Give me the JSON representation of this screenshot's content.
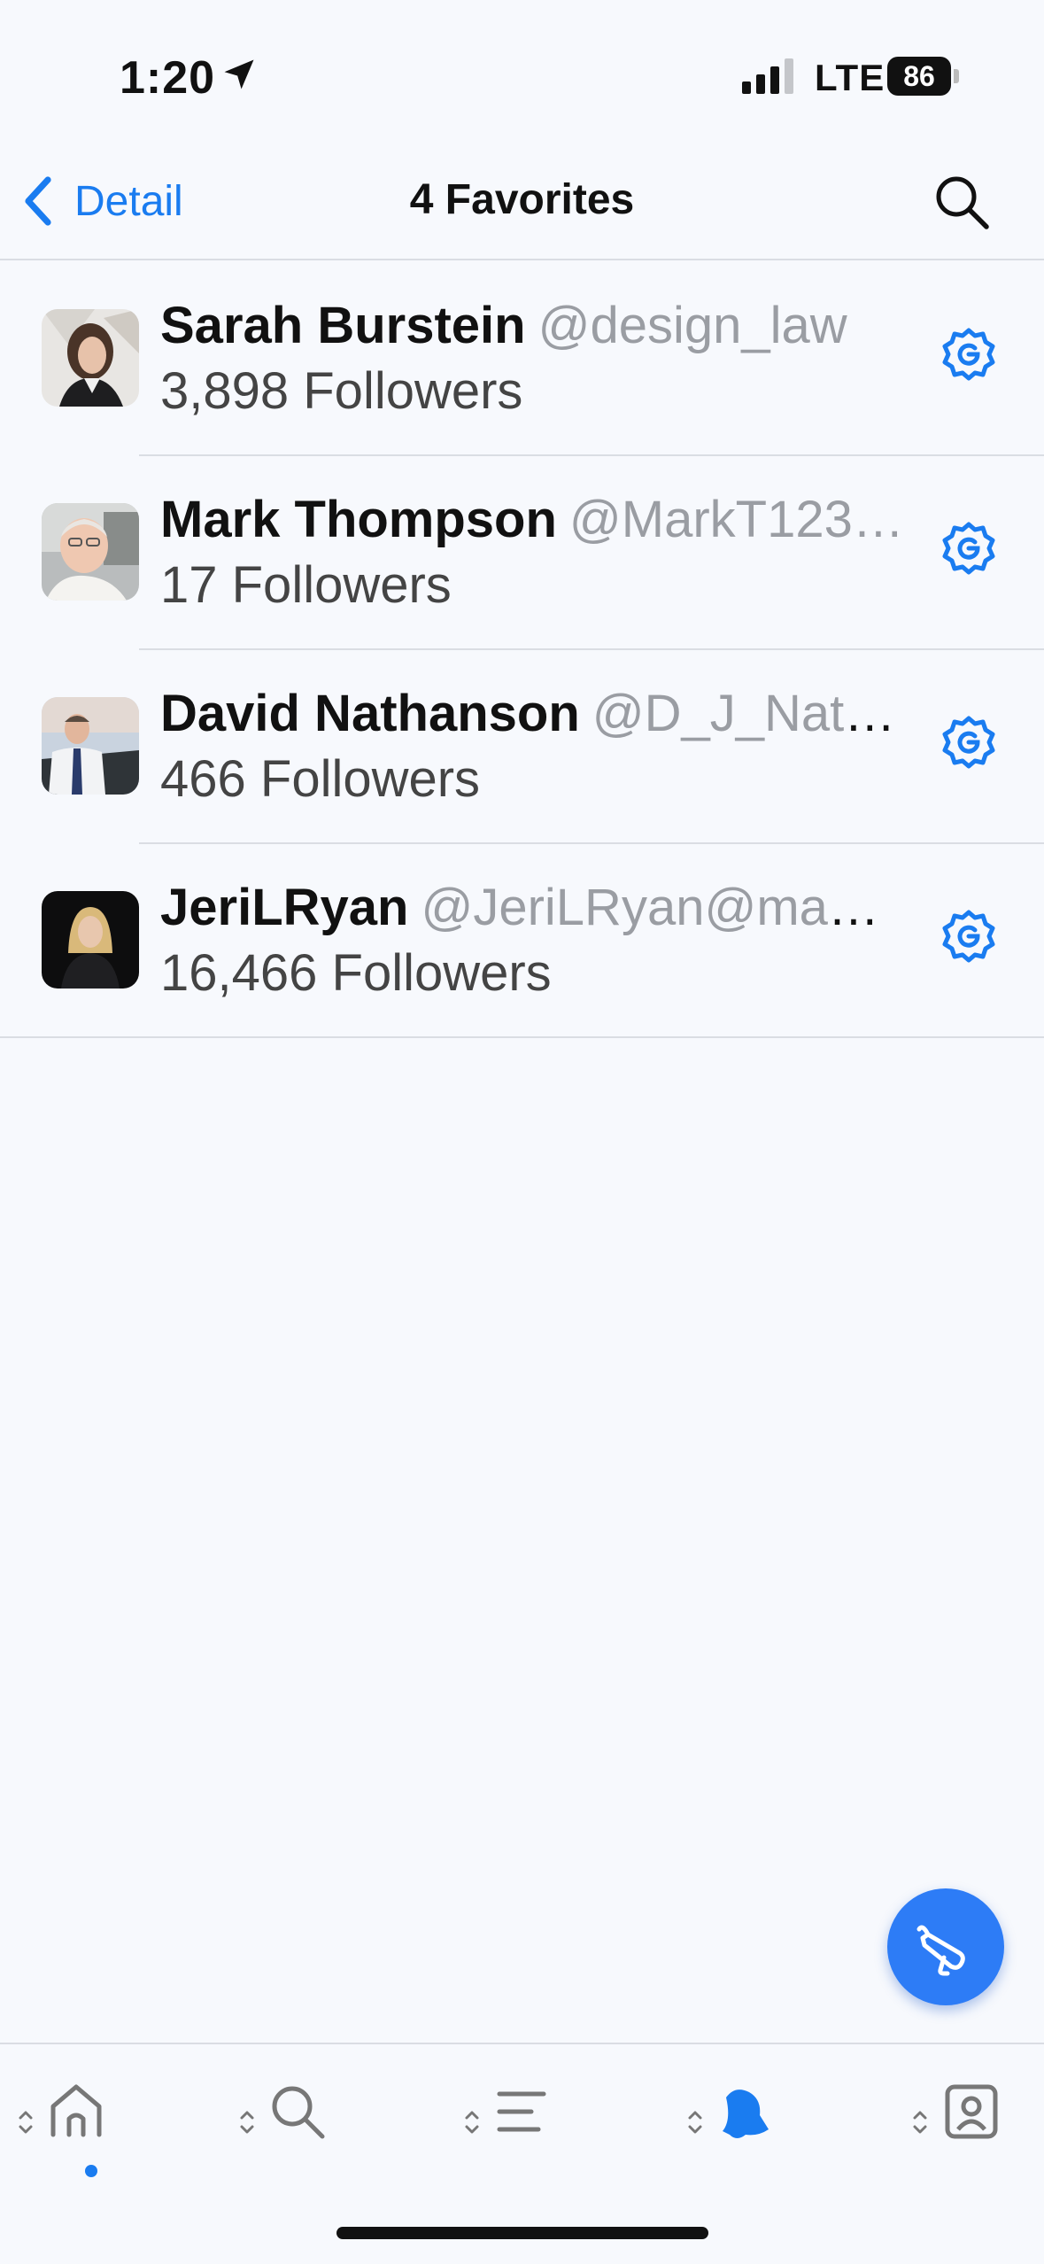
{
  "status_bar": {
    "time": "1:20",
    "network": "LTE",
    "battery": "86"
  },
  "nav": {
    "back_label": "Detail",
    "title": "4 Favorites"
  },
  "accounts": [
    {
      "name": "Sarah Burstein",
      "handle": "@design_law",
      "followers": "3,898 Followers"
    },
    {
      "name": "Mark Thompson",
      "handle": "@MarkT123…",
      "followers": "17 Followers"
    },
    {
      "name": "David Nathanson",
      "handle": "@D_J_Nath…",
      "followers": "466 Followers"
    },
    {
      "name": "JeriLRyan",
      "handle": "@JeriLRyan@masto…",
      "followers": "16,466 Followers"
    }
  ],
  "tabs": [
    {
      "icon": "home-icon",
      "active": true
    },
    {
      "icon": "search-icon",
      "active": false
    },
    {
      "icon": "lists-icon",
      "active": false
    },
    {
      "icon": "notifications-bell-icon",
      "active": false
    },
    {
      "icon": "profile-icon",
      "active": false
    }
  ],
  "colors": {
    "accent": "#1a7cf0",
    "fab": "#2d7cf6",
    "background": "#f7f9fd",
    "divider": "#dadde3"
  }
}
